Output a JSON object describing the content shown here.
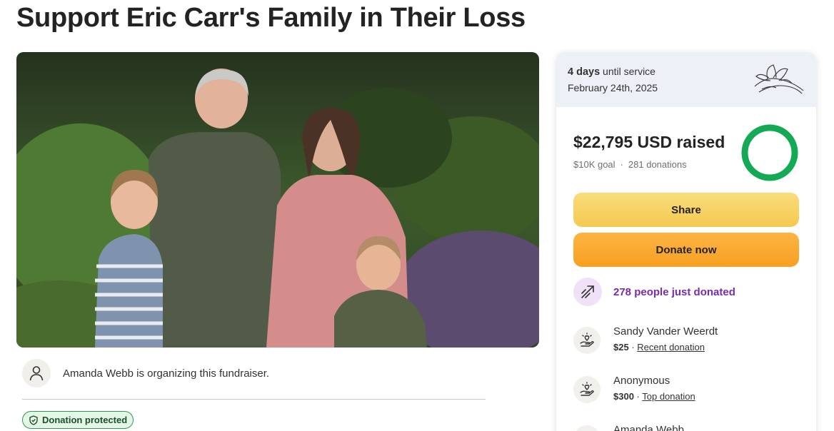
{
  "page": {
    "title": "Support Eric Carr's Family in Their Loss"
  },
  "organizer": {
    "text": "Amanda Webb is organizing this fundraiser."
  },
  "badge": {
    "label": "Donation protected"
  },
  "service": {
    "days": "4 days",
    "until": "until service",
    "date": "February 24th, 2025"
  },
  "progress": {
    "raised": "$22,795 USD raised",
    "goal": "$10K goal",
    "separator": "·",
    "donations": "281 donations",
    "fraction": 1.0
  },
  "buttons": {
    "share": "Share",
    "donate": "Donate now"
  },
  "trend": {
    "text": "278 people just donated"
  },
  "donors": [
    {
      "name": "Sandy Vander Weerdt",
      "amount": "$25",
      "sep": " · ",
      "tag": "Recent donation"
    },
    {
      "name": "Anonymous",
      "amount": "$300",
      "sep": " · ",
      "tag": "Top donation"
    },
    {
      "name": "Amanda Webb",
      "amount": "",
      "sep": "",
      "tag": ""
    }
  ],
  "colors": {
    "accent_green": "#2c9a54",
    "share_yellow": "#f7d260",
    "donate_orange": "#f9a93a",
    "trend_purple": "#7b2aa8"
  },
  "icons": {
    "organizer": "person-icon",
    "badge": "shield-icon",
    "service": "lily-flower-icon",
    "trend": "trending-up-icon",
    "donor": "heart-hand-icon"
  }
}
